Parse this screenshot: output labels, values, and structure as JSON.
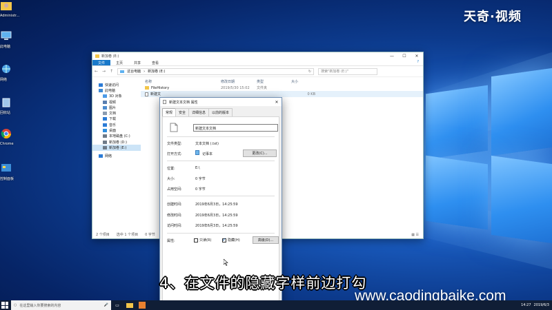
{
  "brand": {
    "logo": "天奇·视频",
    "website": "www.caodingbaike.com"
  },
  "caption": "4、在文件的隐藏字样前边打勾",
  "desktop": {
    "icons": [
      {
        "label": "Administr...",
        "icon": "user-folder-icon"
      },
      {
        "label": "此电脑",
        "icon": "this-pc-icon"
      },
      {
        "label": "网络",
        "icon": "network-icon"
      },
      {
        "label": "回收站",
        "icon": "recycle-bin-icon"
      },
      {
        "label": "Chrome",
        "icon": "chrome-icon"
      },
      {
        "label": "控制面板",
        "icon": "control-panel-icon"
      }
    ]
  },
  "explorer": {
    "title": "新加卷 (E:)",
    "window_buttons": {
      "minimize": "—",
      "maximize": "☐",
      "close": "✕"
    },
    "ribbon_tabs": [
      "文件",
      "主页",
      "共享",
      "查看"
    ],
    "help": "?",
    "address": {
      "back": "←",
      "forward": "→",
      "up": "↑",
      "path": [
        "这台电脑",
        "新加卷 (E:)"
      ],
      "refresh": "↻"
    },
    "search_placeholder": "搜索\"新加卷 (E:)\"",
    "nav": [
      {
        "label": "快速访问",
        "level": 1,
        "color": "#2b7bd6"
      },
      {
        "label": "此电脑",
        "level": 1,
        "color": "#3d8ad6"
      },
      {
        "label": "3D 对象",
        "level": 2,
        "color": "#4c9be8"
      },
      {
        "label": "视频",
        "level": 2,
        "color": "#5a7fb0"
      },
      {
        "label": "图片",
        "level": 2,
        "color": "#4d8ccf"
      },
      {
        "label": "文档",
        "level": 2,
        "color": "#8a9bb0"
      },
      {
        "label": "下载",
        "level": 2,
        "color": "#2b7bd6"
      },
      {
        "label": "音乐",
        "level": 2,
        "color": "#2b7bd6"
      },
      {
        "label": "桌面",
        "level": 2,
        "color": "#2f8fdf"
      },
      {
        "label": "本地磁盘 (C:)",
        "level": 2,
        "color": "#6d7a88"
      },
      {
        "label": "新加卷 (D:)",
        "level": 2,
        "color": "#6d7a88"
      },
      {
        "label": "新加卷 (E:)",
        "level": 2,
        "color": "#6d7a88",
        "selected": true
      },
      {
        "label": "网络",
        "level": 1,
        "color": "#2b7bd6",
        "gap_before": true
      }
    ],
    "columns": [
      "名称",
      "修改日期",
      "类型",
      "大小"
    ],
    "rows": [
      {
        "name": "FileHistory",
        "date": "2019/5/30 15:02",
        "type": "文件夹",
        "size": "",
        "icon": "folder-icon"
      },
      {
        "name": "新建文",
        "date": "",
        "type": "",
        "size": "0 KB",
        "icon": "text-file-icon",
        "selected": true
      }
    ],
    "status": {
      "count": "2 个项目",
      "selected": "选中 1 个项目",
      "size": "0 字节"
    }
  },
  "dialog": {
    "title": "新建文本文档 属性",
    "close": "✕",
    "tabs": [
      "常规",
      "安全",
      "详细信息",
      "以前的版本"
    ],
    "filename": "新建文本文档",
    "fields": {
      "type_label": "文件类型:",
      "type_value": "文本文档 (.txt)",
      "open_label": "打开方式:",
      "open_value": "记事本",
      "change_button": "更改(C)...",
      "location_label": "位置:",
      "location_value": "E:\\",
      "size_label": "大小:",
      "size_value": "0 字节",
      "disk_label": "占用空间:",
      "disk_value": "0 字节",
      "created_label": "创建时间:",
      "created_value": "2019年6月3日，14:25:59",
      "modified_label": "修改时间:",
      "modified_value": "2019年6月3日，14:25:59",
      "accessed_label": "访问时间:",
      "accessed_value": "2019年6月3日，14:25:59",
      "attr_label": "属性:",
      "readonly_label": "只读(R)",
      "hidden_label": "隐藏(H)",
      "advanced_button": "高级(D)..."
    },
    "readonly_checked": false,
    "hidden_checked": true
  },
  "taskbar": {
    "search_placeholder": "在这里输入你要搜索的内容",
    "clock_time": "14:27",
    "clock_date": "2019/6/3"
  }
}
